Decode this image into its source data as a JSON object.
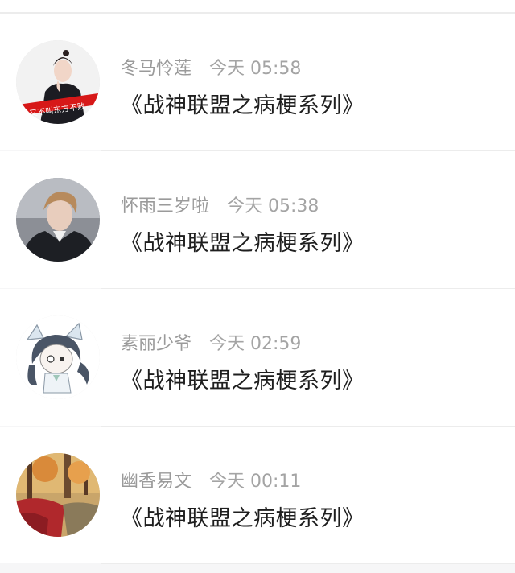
{
  "messages": [
    {
      "author": "冬马怜莲",
      "time": "今天 05:58",
      "title": "《战神联盟之病梗系列》",
      "avatar_icon": "woman-portrait-avatar",
      "avatar_banner": "我又不叫东方不败"
    },
    {
      "author": "怀雨三岁啦",
      "time": "今天 05:38",
      "title": "《战神联盟之病梗系列》",
      "avatar_icon": "man-portrait-avatar"
    },
    {
      "author": "素丽少爷",
      "time": "今天 02:59",
      "title": "《战神联盟之病梗系列》",
      "avatar_icon": "anime-cat-avatar"
    },
    {
      "author": "幽香易文",
      "time": "今天 00:11",
      "title": "《战神联盟之病梗系列》",
      "avatar_icon": "autumn-forest-avatar"
    }
  ],
  "colors": {
    "name_text": "#9a9a9a",
    "title_text": "#1e1e1e",
    "divider": "#ececec",
    "background": "#f6f6f7"
  }
}
